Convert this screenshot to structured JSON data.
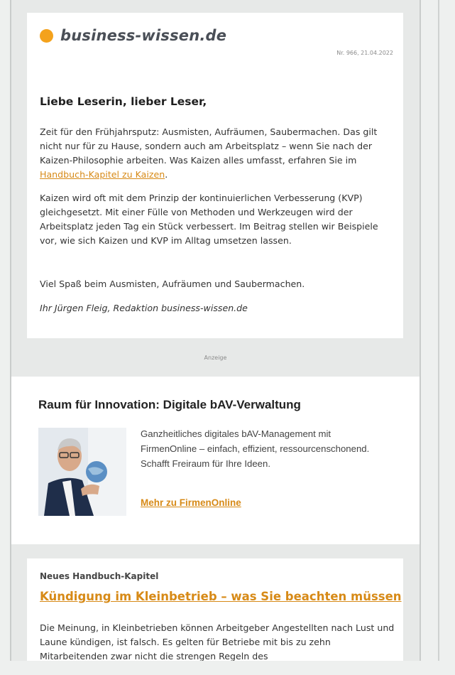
{
  "header": {
    "brand_name": "business-wissen.de",
    "issue": "Nr. 966, 21.04.2022"
  },
  "letter": {
    "greeting": "Liebe Leserin, lieber Leser,",
    "p1_text": "Zeit für den Frühjahrsputz: Ausmisten, Aufräumen, Saubermachen. Das gilt nicht nur für zu Hause, sondern auch am Arbeitsplatz – wenn Sie nach der Kaizen-Philosophie arbeiten. Was Kaizen alles umfasst, erfahren Sie im ",
    "p1_link": "Handbuch-Kapitel zu Kaizen",
    "p1_end": ".",
    "p2": "Kaizen wird oft mit dem Prinzip der kontinuierlichen Verbesserung (KVP) gleichgesetzt. Mit einer Fülle von Methoden und Werkzeugen wird der Arbeitsplatz jeden Tag ein Stück verbessert. Im Beitrag stellen wir Beispiele vor, wie sich Kaizen und KVP im Alltag umsetzen lassen.",
    "p3": "Viel Spaß beim Ausmisten, Aufräumen und Saubermachen.",
    "signature": "Ihr Jürgen Fleig, Redaktion business-wissen.de"
  },
  "ad": {
    "label": "Anzeige",
    "title": "Raum für Innovation: Digitale bAV-Verwaltung",
    "text": "Ganzheitliches digitales bAV-Management mit FirmenOnline – einfach, effizient, ressourcenschonend. Schafft Freiraum für Ihre Ideen.",
    "link": "Mehr zu FirmenOnline"
  },
  "news": {
    "kicker": "Neues Handbuch-Kapitel",
    "title": "Kündigung im Kleinbetrieb – was Sie beachten müssen",
    "text": "Die Meinung, in Kleinbetrieben können Arbeitgeber Angestellten nach Lust und Laune kündigen, ist falsch. Es gelten für Betriebe mit bis zu zehn Mitarbeitenden zwar nicht die strengen Regeln des"
  },
  "colors": {
    "accent": "#d78a17",
    "brand_dot": "#f4a21c"
  }
}
